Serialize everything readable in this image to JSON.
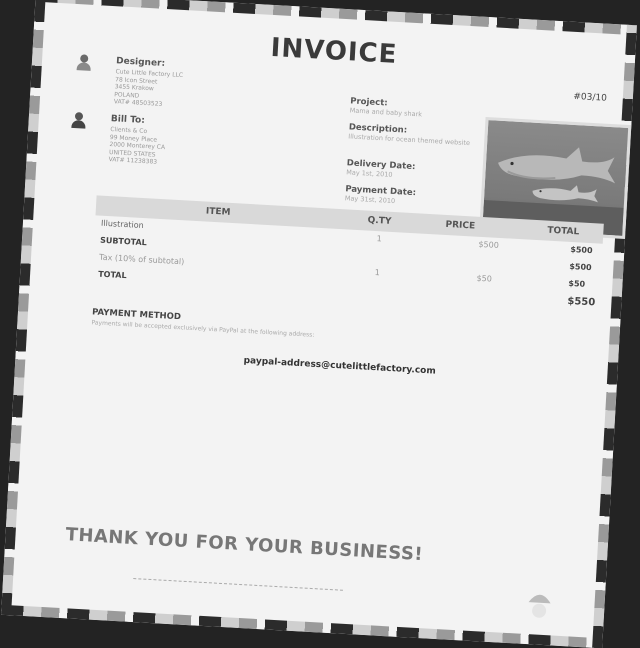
{
  "invoice": {
    "title": "INVOICE",
    "number": "#03/10"
  },
  "designer": {
    "label": "Designer:",
    "lines": [
      "Cute Little Factory LLC",
      "78 Icon Street",
      "3455 Krakow",
      "POLAND",
      "VAT# 48503523"
    ]
  },
  "bill_to": {
    "label": "Bill To:",
    "lines": [
      "Clients & Co",
      "99 Money Place",
      "2000 Monterey CA",
      "UNITED STATES",
      "VAT# 11238383"
    ]
  },
  "project": {
    "project_label": "Project:",
    "project_value": "Mama and baby shark",
    "description_label": "Description:",
    "description_value": "Illustration for ocean themed website",
    "delivery_label": "Delivery Date:",
    "delivery_value": "May 1st, 2010",
    "payment_label": "Payment Date:",
    "payment_value": "May 31st, 2010"
  },
  "table": {
    "headers": {
      "item": "ITEM",
      "qty": "Q.TY",
      "price": "PRICE",
      "total": "TOTAL"
    },
    "row1": {
      "item": "Illustration",
      "qty": "1",
      "price": "$500",
      "total": "$500"
    },
    "subtotal": {
      "label": "SUBTOTAL",
      "total": "$500"
    },
    "tax": {
      "label": "Tax (10% of subtotal)",
      "qty": "1",
      "price": "$50",
      "total": "$50"
    },
    "total": {
      "label": "TOTAL",
      "total": "$550"
    }
  },
  "payment": {
    "title": "PAYMENT METHOD",
    "text": "Payments will be accepted exclusively via PayPal at the following address:",
    "address": "paypal-address@cutelittlefactory.com"
  },
  "footer": {
    "thanks": "THANK YOU FOR YOUR BUSINESS!"
  },
  "icons": [
    "designer-avatar-icon",
    "client-avatar-icon",
    "shark-illustration"
  ]
}
